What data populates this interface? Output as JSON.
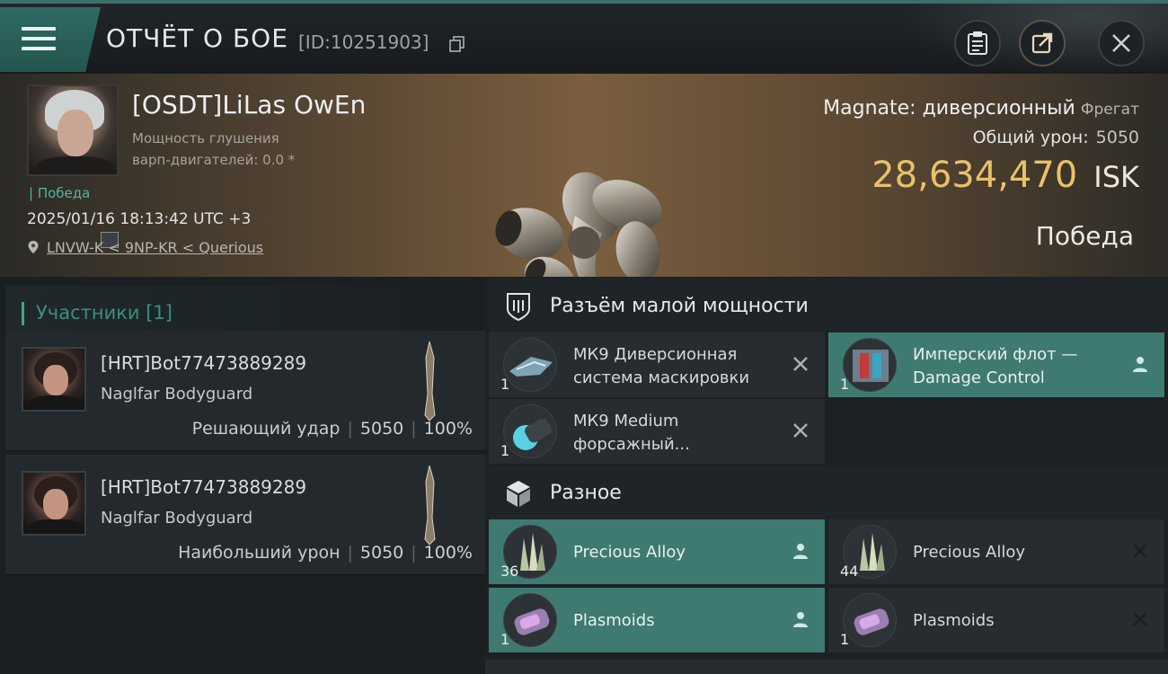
{
  "header": {
    "title": "ОТЧЁТ О БОЕ",
    "report_id": "[ID:10251903]"
  },
  "pilot": {
    "name": "[OSDT]LiLas OwEn",
    "warp_line1": "Мощность глушения",
    "warp_line2": "варп-двигателей: 0.0 *",
    "status": "| Победа",
    "datetime": "2025/01/16 18:13:42 UTC +3",
    "location": "LNVW-K < 9NP-KR < Querious"
  },
  "summary": {
    "ship_name": "Magnate: диверсионный",
    "ship_class": "Фрегат",
    "total_damage_label": "Общий урон:",
    "total_damage_value": "5050",
    "isk_value": "28,634,470",
    "isk_unit": "ISK",
    "result": "Победа"
  },
  "participants": {
    "header": "Участники [1]",
    "rows": [
      {
        "name": "[HRT]Bot77473889289",
        "ship": "Naglfar Bodyguard",
        "label": "Решающий удар",
        "damage": "5050",
        "percent": "100%"
      },
      {
        "name": "[HRT]Bot77473889289",
        "ship": "Naglfar Bodyguard",
        "label": "Наибольший урон",
        "damage": "5050",
        "percent": "100%"
      }
    ]
  },
  "modules": {
    "low_slot": {
      "title": "Разъём малой мощности",
      "items": [
        {
          "qty": "1",
          "name": "МК9 Диверсионная система маскировки"
        },
        {
          "qty": "1",
          "name": "Имперский флот — Damage Control"
        },
        {
          "qty": "1",
          "name": "МК9 Medium форсажный..."
        }
      ]
    },
    "misc": {
      "title": "Разное",
      "items": [
        {
          "qty": "36",
          "name": "Precious Alloy"
        },
        {
          "qty": "44",
          "name": "Precious Alloy"
        },
        {
          "qty": "1",
          "name": "Plasmoids"
        },
        {
          "qty": "1",
          "name": "Plasmoids"
        }
      ]
    }
  },
  "colors": {
    "accent_teal": "#3f7a72",
    "isk_gold": "#e8c16a",
    "victory_green": "#4fb59f"
  }
}
